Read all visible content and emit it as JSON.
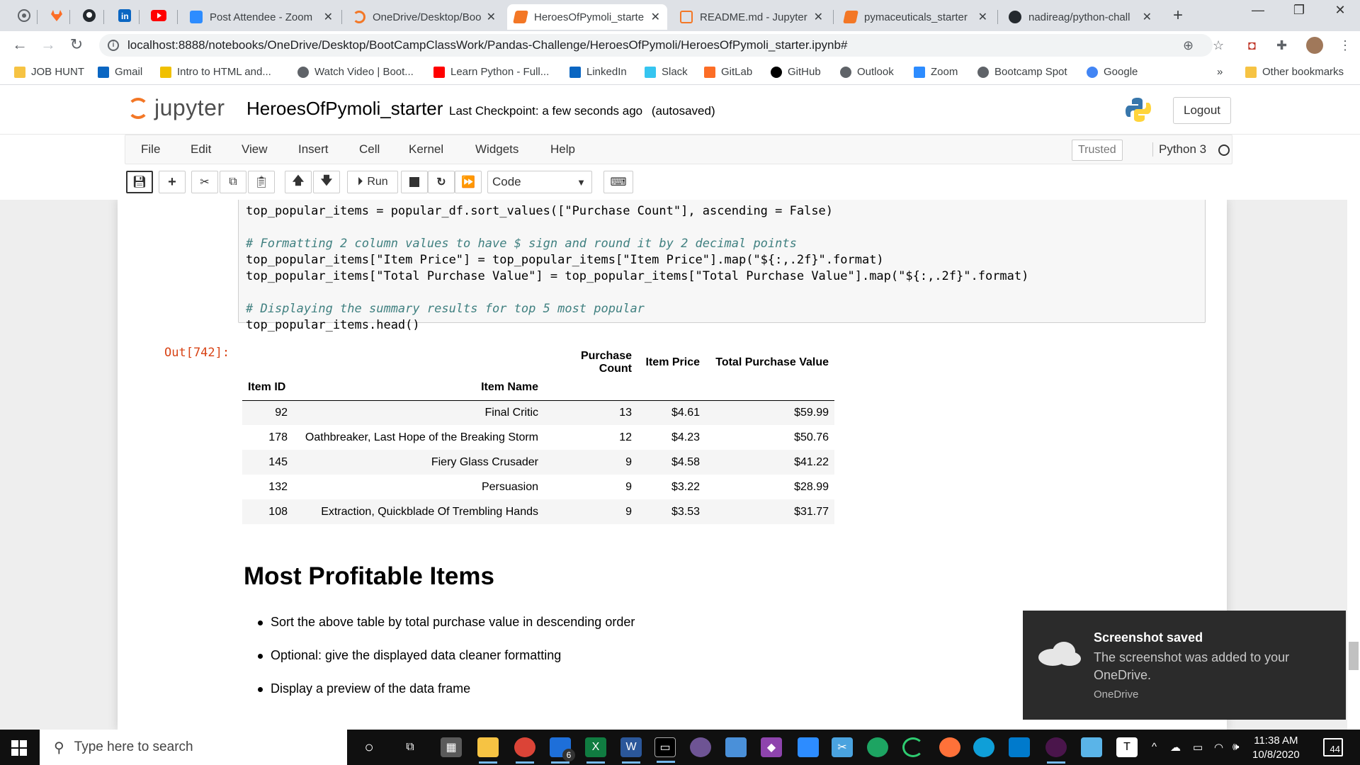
{
  "browser": {
    "tabs": [
      {
        "title": "Post Attendee - Zoom",
        "color": "#2d8cff"
      },
      {
        "title": "OneDrive/Desktop/Boo",
        "color": "#f37726"
      },
      {
        "title": "HeroesOfPymoli_starte",
        "color": "#f37726"
      },
      {
        "title": "README.md - Jupyter",
        "color": "#f37726"
      },
      {
        "title": "pymaceuticals_starter",
        "color": "#f37726"
      },
      {
        "title": "nadireag/python-chall",
        "color": "#000000"
      }
    ],
    "url": "localhost:8888/notebooks/OneDrive/Desktop/BootCampClassWork/Pandas-Challenge/HeroesOfPymoli/HeroesOfPymoli_starter.ipynb#",
    "bookmarks": [
      {
        "label": "JOB HUNT",
        "color": "#f6c343"
      },
      {
        "label": "Gmail",
        "color": "#0a66c2"
      },
      {
        "label": "Intro to HTML and...",
        "color": "#f0c000"
      },
      {
        "label": "Watch Video | Boot...",
        "color": "#5f6368"
      },
      {
        "label": "Learn Python - Full...",
        "color": "#ff0000"
      },
      {
        "label": "LinkedIn",
        "color": "#0a66c2"
      },
      {
        "label": "Slack",
        "color": "#36c5f0"
      },
      {
        "label": "GitLab",
        "color": "#fc6d26"
      },
      {
        "label": "GitHub",
        "color": "#000000"
      },
      {
        "label": "Outlook",
        "color": "#5f6368"
      },
      {
        "label": "Zoom",
        "color": "#2d8cff"
      },
      {
        "label": "Bootcamp Spot",
        "color": "#5f6368"
      },
      {
        "label": "Google",
        "color": "#4285f4"
      }
    ],
    "more_bookmarks": "»",
    "other_bookmarks": "Other bookmarks"
  },
  "jupyter": {
    "logo_text": "jupyter",
    "notebook_name": "HeroesOfPymoli_starter",
    "checkpoint": "Last Checkpoint: a few seconds ago",
    "autosave": "(autosaved)",
    "logout": "Logout",
    "menus": [
      "File",
      "Edit",
      "View",
      "Insert",
      "Cell",
      "Kernel",
      "Widgets",
      "Help"
    ],
    "trusted": "Trusted",
    "kernel_name": "Python 3",
    "run_label": "Run",
    "cell_type": "Code"
  },
  "code": {
    "line1": "top_popular_items = popular_df.sort_values([\"Purchase Count\"], ascending = False)",
    "comment1": "# Formatting 2 column values to have $ sign and round it by 2 decimal points",
    "line2": "top_popular_items[\"Item Price\"] = top_popular_items[\"Item Price\"].map(\"${:,.2f}\".format)",
    "line3": "top_popular_items[\"Total Purchase Value\"] = top_popular_items[\"Total Purchase Value\"].map(\"${:,.2f}\".format)",
    "comment2": "# Displaying the summary results for top 5 most popular",
    "line4": "top_popular_items.head()"
  },
  "output": {
    "prompt": "Out[742]:",
    "col_headers": [
      "Purchase Count",
      "Item Price",
      "Total Purchase Value"
    ],
    "index_headers": [
      "Item ID",
      "Item Name"
    ],
    "rows": [
      [
        "92",
        "Final Critic",
        "13",
        "$4.61",
        "$59.99"
      ],
      [
        "178",
        "Oathbreaker, Last Hope of the Breaking Storm",
        "12",
        "$4.23",
        "$50.76"
      ],
      [
        "145",
        "Fiery Glass Crusader",
        "9",
        "$4.58",
        "$41.22"
      ],
      [
        "132",
        "Persuasion",
        "9",
        "$3.22",
        "$28.99"
      ],
      [
        "108",
        "Extraction, Quickblade Of Trembling Hands",
        "9",
        "$3.53",
        "$31.77"
      ]
    ]
  },
  "markdown": {
    "heading": "Most Profitable Items",
    "bullets": [
      "Sort the above table by total purchase value in descending order",
      "Optional: give the displayed data cleaner formatting",
      "Display a preview of the data frame"
    ]
  },
  "toast": {
    "title": "Screenshot saved",
    "body": "The screenshot was added to your OneDrive.",
    "source": "OneDrive"
  },
  "taskbar": {
    "search_placeholder": "Type here to search",
    "mail_badge": "6",
    "time": "11:38 AM",
    "date": "10/8/2020",
    "notifications": "44"
  }
}
